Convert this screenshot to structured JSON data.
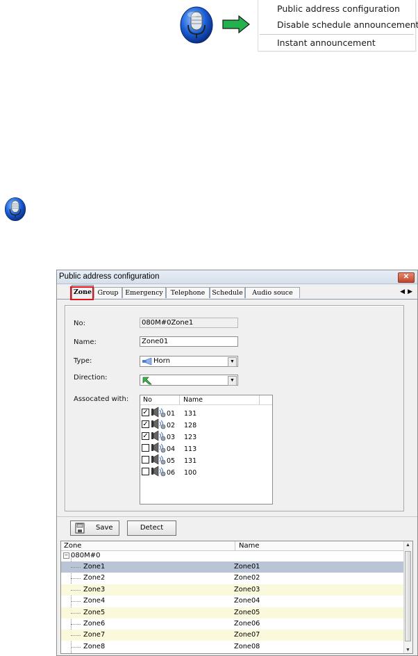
{
  "context_menu": {
    "items": [
      "Public address configuration",
      "Disable schedule announcement",
      "Instant announcement"
    ]
  },
  "window": {
    "title": "Public address configuration",
    "close_label": "✕",
    "tabs": [
      "Zone",
      "Group",
      "Emergency",
      "Telephone",
      "Schedule",
      "Audio souce"
    ],
    "active_tab": "Zone",
    "tab_nav": "◀▶"
  },
  "form": {
    "no_label": "No:",
    "no_value": "080M#0Zone1",
    "name_label": "Name:",
    "name_value": "Zone01",
    "type_label": "Type:",
    "type_value": "Horn",
    "direction_label": "Direction:",
    "direction_value": "",
    "assoc_label": "Assocated with:"
  },
  "assoc_list": {
    "columns": [
      "No",
      "Name"
    ],
    "rows": [
      {
        "no": "01",
        "name": "131",
        "checked": true
      },
      {
        "no": "02",
        "name": "128",
        "checked": true
      },
      {
        "no": "03",
        "name": "123",
        "checked": true
      },
      {
        "no": "04",
        "name": "113",
        "checked": false
      },
      {
        "no": "05",
        "name": "131",
        "checked": false
      },
      {
        "no": "06",
        "name": "100",
        "checked": false
      }
    ]
  },
  "buttons": {
    "save": "Save",
    "detect": "Detect"
  },
  "grid": {
    "columns": [
      "Zone",
      "Name"
    ],
    "root": "080M#0",
    "rows": [
      {
        "zone": "Zone1",
        "name": "Zone01",
        "state": "selected"
      },
      {
        "zone": "Zone2",
        "name": "Zone02",
        "state": "normal"
      },
      {
        "zone": "Zone3",
        "name": "Zone03",
        "state": "alt"
      },
      {
        "zone": "Zone4",
        "name": "Zone04",
        "state": "normal"
      },
      {
        "zone": "Zone5",
        "name": "Zone05",
        "state": "alt"
      },
      {
        "zone": "Zone6",
        "name": "Zone06",
        "state": "normal"
      },
      {
        "zone": "Zone7",
        "name": "Zone07",
        "state": "alt"
      },
      {
        "zone": "Zone8",
        "name": "Zone08",
        "state": "normal"
      }
    ]
  },
  "colors": {
    "selected_row": "#b9c4d6",
    "alt_row": "#fbf9dc",
    "highlight_box": "#e0141a",
    "arrow_green": "#22b14c"
  }
}
